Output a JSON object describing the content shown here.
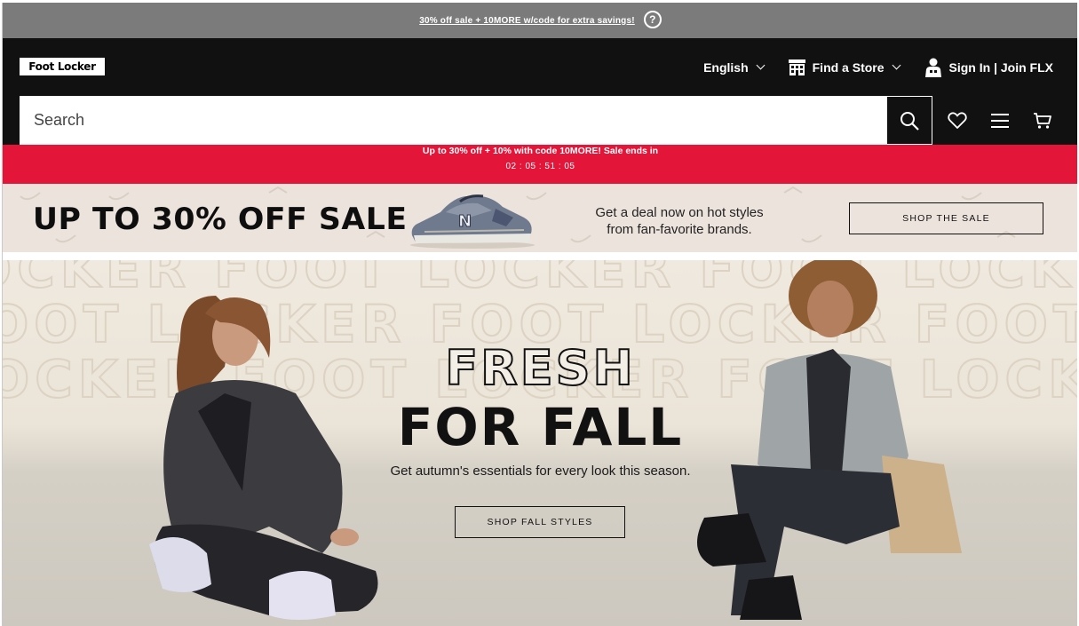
{
  "promo_strip": {
    "text": "30% off sale + 10MORE w/code for extra savings!",
    "help_symbol": "?"
  },
  "header": {
    "logo_text": "Foot Locker",
    "language": "English",
    "find_store": "Find a Store",
    "sign_in": "Sign In | Join FLX"
  },
  "search": {
    "placeholder": "Search"
  },
  "sale_banner": {
    "message": "Up to 30% off + 10% with code 10MORE! Sale ends in",
    "countdown": "02 : 05 : 51 : 05",
    "color": "#e3163a"
  },
  "sale_strip": {
    "headline": "UP TO 30% OFF SALE",
    "subtext_line1": "Get a deal now on hot styles",
    "subtext_line2": "from fan-favorite brands.",
    "cta": "SHOP THE SALE"
  },
  "hero": {
    "bg_text": "FOOT LOCKER FOOT LOCKER FOOT LOCKER FOOT",
    "headline_outline": "FRESH",
    "headline_solid": "FOR FALL",
    "subtext": "Get autumn's essentials for every look this season.",
    "cta": "SHOP FALL STYLES"
  },
  "icons": [
    "help-icon",
    "store-icon",
    "person-icon",
    "search-icon",
    "heart-icon",
    "menu-icon",
    "cart-icon",
    "chevron-down-icon"
  ]
}
